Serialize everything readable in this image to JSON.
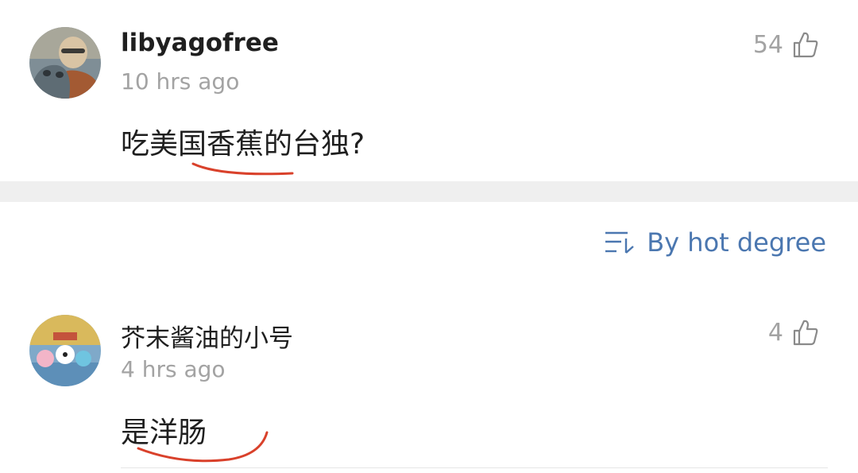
{
  "comments": [
    {
      "username": "libyagofree",
      "timestamp": "10 hrs ago",
      "text": "吃美国香蕉的台独?",
      "likes": "54"
    },
    {
      "username": "芥末酱油的小号",
      "timestamp": "4 hrs ago",
      "text": "是洋肠",
      "likes": "4"
    }
  ],
  "sort": {
    "label": "By hot degree",
    "icon": "sort-icon"
  },
  "colors": {
    "accent": "#4b77b0",
    "muted": "#a3a3a3",
    "text": "#1f1f1f",
    "underline": "#d9412b",
    "band": "#efefef"
  }
}
